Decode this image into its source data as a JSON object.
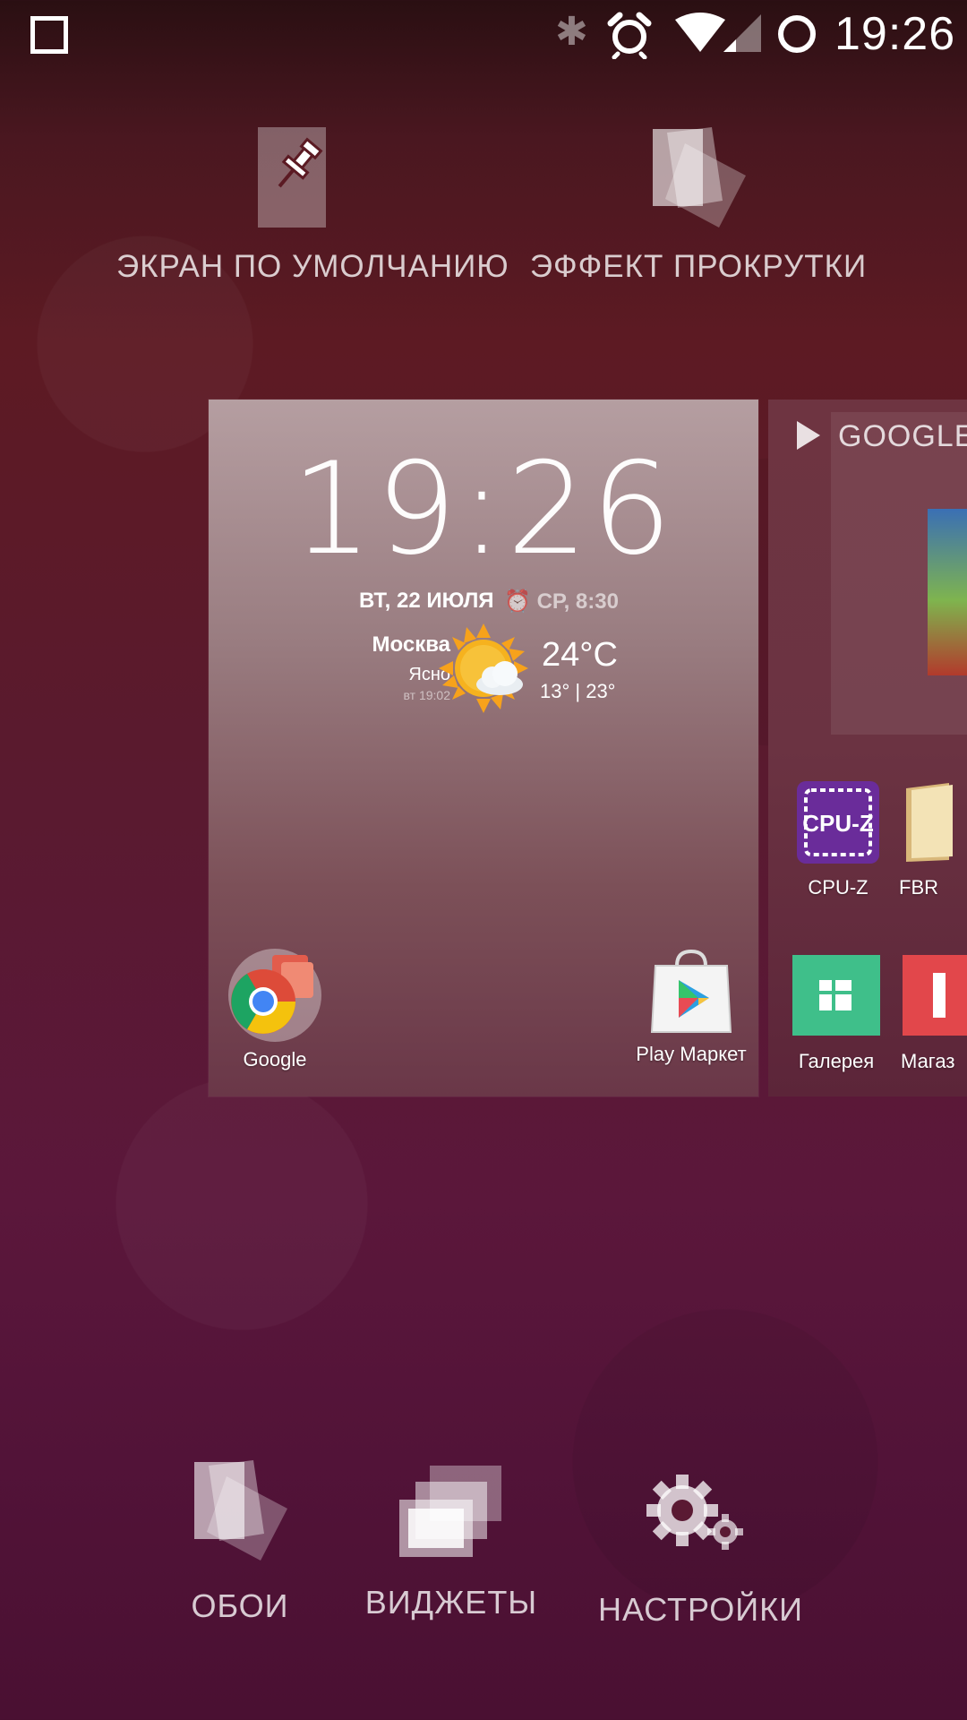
{
  "status_bar": {
    "time": "19:26",
    "icons": [
      "square-icon",
      "bluetooth-icon",
      "alarm-icon",
      "wifi-icon",
      "signal-icon",
      "loading-circle-icon"
    ]
  },
  "top_actions": {
    "default_screen": {
      "label": "ЭКРАН ПО УМОЛЧАНИЮ",
      "icon": "pin-icon"
    },
    "scroll_effect": {
      "label": "ЭФФЕКТ ПРОКРУТКИ",
      "icon": "stacked-pages-icon"
    }
  },
  "panel_main": {
    "clock": "19:26",
    "date": "ВТ, 22 ИЮЛЯ",
    "alarm": "СР, 8:30",
    "weather": {
      "city": "Москва",
      "condition": "Ясно",
      "updated": "вт 19:02",
      "temp": "24°C",
      "range": "13° | 23°",
      "icon": "sun-cloud-icon"
    },
    "apps": [
      {
        "label": "Google",
        "icon": "chrome-folder-icon"
      },
      {
        "label": "Play Маркет",
        "icon": "play-store-icon"
      }
    ]
  },
  "panel_second": {
    "store_header": "GOOGLE",
    "apps": [
      {
        "label": "CPU-Z",
        "icon": "cpu-z-icon"
      },
      {
        "label": "FBR",
        "icon": "book-icon"
      },
      {
        "label": "Галерея",
        "icon": "gallery-icon"
      },
      {
        "label": "Магаз",
        "icon": "shop-icon"
      }
    ]
  },
  "bottom_actions": {
    "wallpapers": {
      "label": "ОБОИ",
      "icon": "wallpaper-icon"
    },
    "widgets": {
      "label": "ВИДЖЕТЫ",
      "icon": "widgets-icon"
    },
    "settings": {
      "label": "НАСТРОЙКИ",
      "icon": "gear-icon"
    }
  },
  "colors": {
    "accent_purple": "#6a2c9a",
    "gallery_green": "#3fbf8a",
    "shop_red": "#e2474b",
    "sun_orange": "#f7a21b"
  }
}
